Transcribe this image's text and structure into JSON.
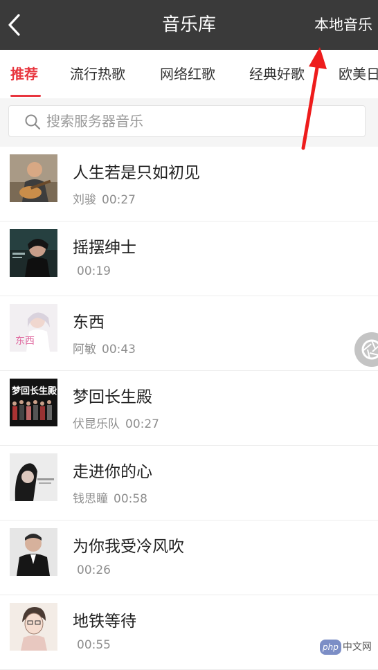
{
  "header": {
    "title": "音乐库",
    "right_action": "本地音乐"
  },
  "tabs": [
    {
      "label": "推荐",
      "active": true
    },
    {
      "label": "流行热歌",
      "active": false
    },
    {
      "label": "网络红歌",
      "active": false
    },
    {
      "label": "经典好歌",
      "active": false
    },
    {
      "label": "欧美日",
      "active": false
    }
  ],
  "search": {
    "placeholder": "搜索服务器音乐",
    "icon": "search-icon"
  },
  "songs": [
    {
      "title": "人生若是只如初见",
      "artist": "刘骏",
      "duration": "00:27"
    },
    {
      "title": "摇摆绅士",
      "artist": "",
      "duration": "00:19"
    },
    {
      "title": "东西",
      "artist": "阿敏",
      "duration": "00:43"
    },
    {
      "title": "梦回长生殿",
      "artist": "伏昆乐队",
      "duration": "00:27"
    },
    {
      "title": "走进你的心",
      "artist": "钱思瞳",
      "duration": "00:58"
    },
    {
      "title": "为你我受冷风吹",
      "artist": "",
      "duration": "00:26"
    },
    {
      "title": "地铁等待",
      "artist": "",
      "duration": "00:55"
    }
  ],
  "covers": {
    "song0": "梦回长生殿",
    "song1": "东西"
  },
  "watermark": {
    "logo": "php",
    "text": "中文网"
  },
  "colors": {
    "topbar": "#3a3a3a",
    "accent": "#e8353e",
    "annotation_arrow": "#ee1c1c"
  }
}
